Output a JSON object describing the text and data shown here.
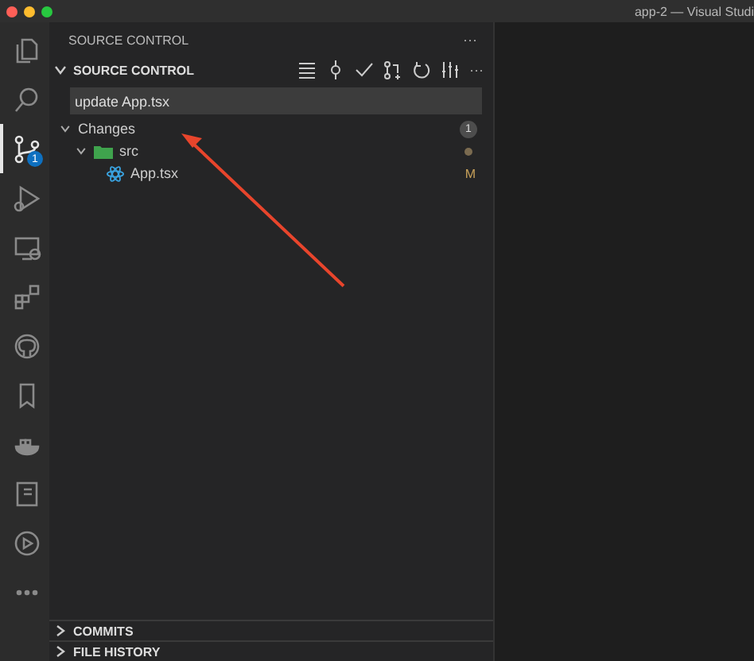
{
  "window": {
    "title": "app-2 — Visual Studi"
  },
  "activity_bar": [
    {
      "selected": false
    },
    {
      "selected": false
    },
    {
      "selected": true,
      "badge": "1"
    },
    {
      "selected": false
    },
    {
      "selected": false
    },
    {
      "selected": false
    },
    {
      "selected": false
    },
    {
      "selected": false
    },
    {
      "selected": false
    },
    {
      "selected": false
    },
    {
      "selected": false
    },
    {
      "selected": false
    }
  ],
  "sidebar": {
    "title": "SOURCE CONTROL",
    "more": "···",
    "section": {
      "title": "SOURCE CONTROL",
      "expanded": true,
      "more": "···"
    },
    "commit_message": {
      "value": "update App.tsx"
    },
    "changes": {
      "label": "Changes",
      "expanded": true,
      "count": "1",
      "children": [
        {
          "label": "src",
          "kind": "folder",
          "expanded": true,
          "children": [
            {
              "label": "App.tsx",
              "kind": "file",
              "status": "M"
            }
          ]
        }
      ]
    },
    "panels": [
      {
        "title": "COMMITS",
        "expanded": false
      },
      {
        "title": "FILE HISTORY",
        "expanded": false
      }
    ]
  }
}
